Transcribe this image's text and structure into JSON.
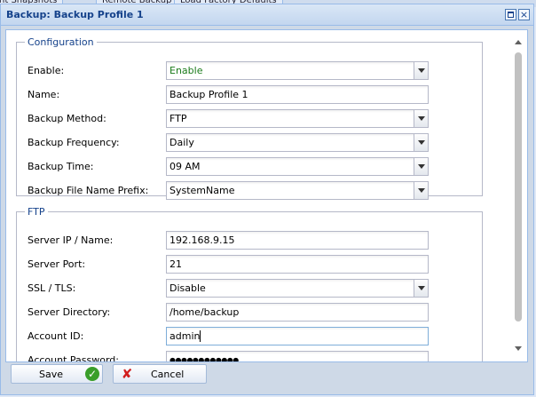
{
  "background_tabs": [
    "nt Snapshots",
    "Remote Backup",
    "Load Factory Defaults"
  ],
  "window": {
    "title": "Backup: Backup Profile 1",
    "maximize_glyph": "",
    "close_glyph": "×"
  },
  "configuration": {
    "legend": "Configuration",
    "fields": [
      {
        "label": "Enable:",
        "value": "Enable",
        "type": "select"
      },
      {
        "label": "Name:",
        "value": "Backup Profile 1",
        "type": "text"
      },
      {
        "label": "Backup Method:",
        "value": "FTP",
        "type": "select"
      },
      {
        "label": "Backup Frequency:",
        "value": "Daily",
        "type": "select"
      },
      {
        "label": "Backup Time:",
        "value": "09 AM",
        "type": "select"
      },
      {
        "label": "Backup File Name Prefix:",
        "value": "SystemName",
        "type": "select"
      }
    ]
  },
  "ftp": {
    "legend": "FTP",
    "fields": [
      {
        "label": "Server IP / Name:",
        "value": "192.168.9.15",
        "type": "text"
      },
      {
        "label": "Server Port:",
        "value": "21",
        "type": "text"
      },
      {
        "label": "SSL / TLS:",
        "value": "Disable",
        "type": "select"
      },
      {
        "label": "Server Directory:",
        "value": "/home/backup",
        "type": "text"
      },
      {
        "label": "Account ID:",
        "value": "admin",
        "type": "text"
      },
      {
        "label": "Account Password:",
        "value": "●●●●●●●●●●●●",
        "type": "password"
      }
    ]
  },
  "buttons": {
    "save": "Save",
    "cancel": "Cancel",
    "save_icon": "✓",
    "cancel_icon": "✘"
  },
  "colors": {
    "title_text": "#15428b",
    "enable_value": "#1a7b1a"
  }
}
